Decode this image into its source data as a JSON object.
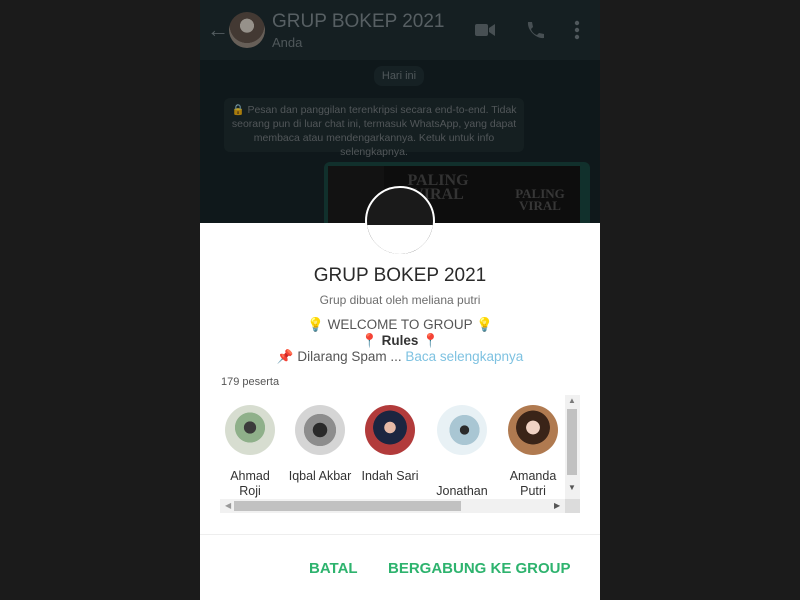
{
  "chat": {
    "title": "GRUP BOKEP 2021",
    "subtitle": "Anda",
    "date_chip": "Hari ini",
    "encryption_notice": "🔒 Pesan dan panggilan terenkripsi secara end-to-end. Tidak seorang pun di luar chat ini, termasuk WhatsApp, yang dapat membaca atau mendengarkannya. Ketuk untuk info selengkapnya.",
    "media_tiles": [
      "PALING VIRAL",
      "PALING VIRAL",
      "PALING VIRAL"
    ],
    "icons": [
      "back-arrow-icon",
      "video-call-icon",
      "phone-icon",
      "more-options-icon"
    ]
  },
  "dialog": {
    "group_name": "GRUP BOKEP 2021",
    "created_by": "Grup dibuat oleh meliana putri",
    "description_line1": "💡 WELCOME TO GROUP 💡",
    "description_rules": "📍 Rules 📍",
    "description_line3": "📌 Dilarang Spam ...",
    "read_more": "Baca selengkapnya",
    "member_count": "179 peserta",
    "members": [
      {
        "name": "Ahmad Roji",
        "color": "#6d8f6a"
      },
      {
        "name": "Iqbal Akbar",
        "color": "#6b6b6b"
      },
      {
        "name": "Indah Sari",
        "color": "#3c4a6e"
      },
      {
        "name": "Jonathan",
        "color": "#c7dde6"
      },
      {
        "name": "Amanda Putri",
        "color": "#8a5a3a"
      }
    ],
    "cancel_label": "BATAL",
    "join_label": "BERGABUNG KE GROUP"
  },
  "colors": {
    "accent": "#2eb36e",
    "link": "#7ec2e1"
  }
}
